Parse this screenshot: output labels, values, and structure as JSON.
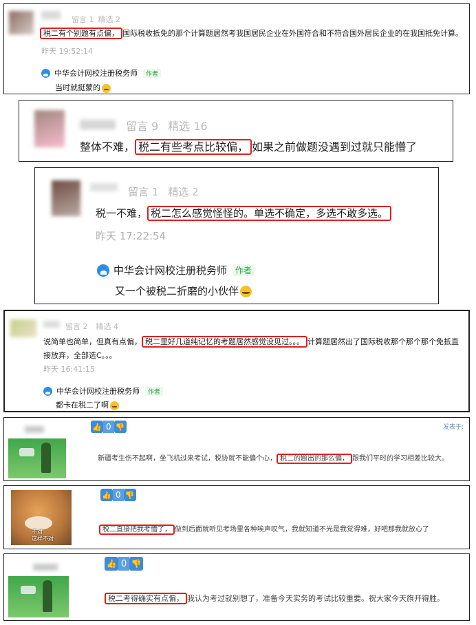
{
  "comments": [
    {
      "meta_msg": "留言 1",
      "meta_pick": "精选 2",
      "before": "",
      "highlight": "税二有个别题有点偏，",
      "after": "国际税收抵免的那个计算题居然考我国居民企业在外国符合和不符合国外居民企业的在我国抵免计算。",
      "time": "昨天 19:52:14",
      "org": "中华会计网校注册税务师",
      "author_tag": "作者",
      "reply": "当时就挺蒙的"
    },
    {
      "meta_msg": "留言 9",
      "meta_pick": "精选 16",
      "before": "整体不难，",
      "highlight": "税二有些考点比较偏，",
      "after": "如果之前做题没遇到过就只能懵了"
    },
    {
      "meta_msg": "留言 1",
      "meta_pick": "精选 2",
      "before": "税一不难，",
      "highlight": "税二怎么感觉怪怪的。单选不确定，多选不敢多选。",
      "after": "",
      "time": "昨天 17:22:54",
      "org": "中华会计网校注册税务师",
      "author_tag": "作者",
      "reply": "又一个被税二折磨的小伙伴"
    },
    {
      "meta_msg": "留言 2",
      "meta_pick": "精选 4",
      "before": "说简单也简单，但真有点偏，",
      "highlight": "税二里好几道纯记忆的考题居然感觉没见过。。。",
      "after": "计算题居然出了国际税收那个那个那个免抵直",
      "line2": "接放弃，全部选C。。。",
      "time": "昨天 16:41:15",
      "org": "中华会计网校注册税务师",
      "author_tag": "作者",
      "reply": "都卡在税二了啊"
    },
    {
      "likes": "0",
      "top_right": "发表于:",
      "before": "新疆考生伤不起啊，坐飞机过来考试，税协就不能偏个心，",
      "highlight": "税二的题出的那么偏，",
      "after": "跟我们平时的学习相差比较大。"
    },
    {
      "likes": "0",
      "pic_caption_1": "不对",
      "pic_caption_2": "这样不对",
      "before": "",
      "highlight": "税二直接把我考懵了，",
      "after": "做到后面就听见考场里各种唉声叹气，我就知道不光是我觉得难，好吧那我就放心了"
    },
    {
      "likes": "0",
      "before": "",
      "highlight": "税二考得确实有点偏，",
      "after": "我认为考过就别想了，准备今天实务的考试比较重要。祝大家今天旗开得胜。"
    }
  ]
}
